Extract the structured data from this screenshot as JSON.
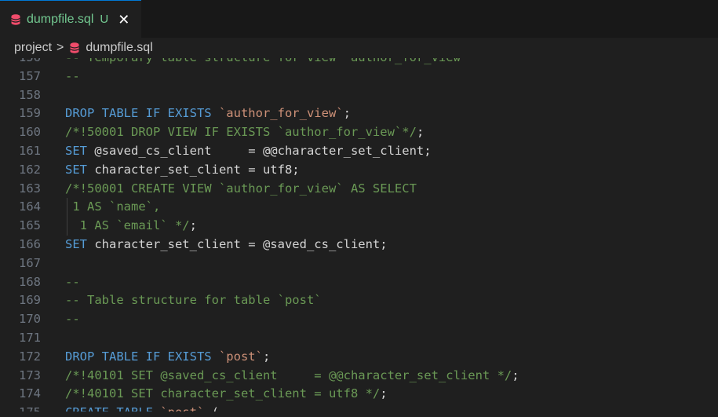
{
  "tab": {
    "icon": "database-icon",
    "filename": "dumpfile.sql",
    "status": "U",
    "close": "✕"
  },
  "breadcrumb": {
    "folder": "project",
    "separator": ">",
    "file": "dumpfile.sql"
  },
  "editor": {
    "lines": [
      {
        "n": "156",
        "tokens": [
          {
            "t": "c",
            "v": "-- Temporary table structure for view `author_for_view`"
          }
        ]
      },
      {
        "n": "157",
        "tokens": [
          {
            "t": "c",
            "v": "--"
          }
        ]
      },
      {
        "n": "158",
        "tokens": []
      },
      {
        "n": "159",
        "tokens": [
          {
            "t": "k",
            "v": "DROP TABLE IF EXISTS "
          },
          {
            "t": "s",
            "v": "`author_for_view`"
          },
          {
            "t": "p",
            "v": ";"
          }
        ]
      },
      {
        "n": "160",
        "tokens": [
          {
            "t": "c",
            "v": "/*!50001 DROP VIEW IF EXISTS `author_for_view`*/"
          },
          {
            "t": "p",
            "v": ";"
          }
        ]
      },
      {
        "n": "161",
        "tokens": [
          {
            "t": "k",
            "v": "SET "
          },
          {
            "t": "p",
            "v": "@saved_cs_client     = @@character_set_client;"
          }
        ]
      },
      {
        "n": "162",
        "tokens": [
          {
            "t": "k",
            "v": "SET "
          },
          {
            "t": "p",
            "v": "character_set_client = utf8;"
          }
        ]
      },
      {
        "n": "163",
        "tokens": [
          {
            "t": "c",
            "v": "/*!50001 CREATE VIEW `author_for_view` AS SELECT"
          }
        ]
      },
      {
        "n": "164",
        "tokens": [
          {
            "t": "c",
            "v": " 1 AS `name`,"
          }
        ]
      },
      {
        "n": "165",
        "tokens": [
          {
            "t": "c",
            "v": "  1 AS `email` */"
          },
          {
            "t": "p",
            "v": ";"
          }
        ]
      },
      {
        "n": "166",
        "tokens": [
          {
            "t": "k",
            "v": "SET "
          },
          {
            "t": "p",
            "v": "character_set_client = @saved_cs_client;"
          }
        ]
      },
      {
        "n": "167",
        "tokens": []
      },
      {
        "n": "168",
        "tokens": [
          {
            "t": "c",
            "v": "--"
          }
        ]
      },
      {
        "n": "169",
        "tokens": [
          {
            "t": "c",
            "v": "-- Table structure for table `post`"
          }
        ]
      },
      {
        "n": "170",
        "tokens": [
          {
            "t": "c",
            "v": "--"
          }
        ]
      },
      {
        "n": "171",
        "tokens": []
      },
      {
        "n": "172",
        "tokens": [
          {
            "t": "k",
            "v": "DROP TABLE IF EXISTS "
          },
          {
            "t": "s",
            "v": "`post`"
          },
          {
            "t": "p",
            "v": ";"
          }
        ]
      },
      {
        "n": "173",
        "tokens": [
          {
            "t": "c",
            "v": "/*!40101 SET @saved_cs_client     = @@character_set_client */"
          },
          {
            "t": "p",
            "v": ";"
          }
        ]
      },
      {
        "n": "174",
        "tokens": [
          {
            "t": "c",
            "v": "/*!40101 SET character_set_client = utf8 */"
          },
          {
            "t": "p",
            "v": ";"
          }
        ]
      },
      {
        "n": "175",
        "tokens": [
          {
            "t": "k",
            "v": "CREATE TABLE "
          },
          {
            "t": "s",
            "v": "`post`"
          },
          {
            "t": "p",
            "v": " ("
          }
        ]
      }
    ]
  },
  "colors": {
    "keyword": "#569cd6",
    "comment": "#6a9955",
    "string": "#ce9178",
    "plain": "#d4d4d4",
    "untracked": "#73c991"
  }
}
